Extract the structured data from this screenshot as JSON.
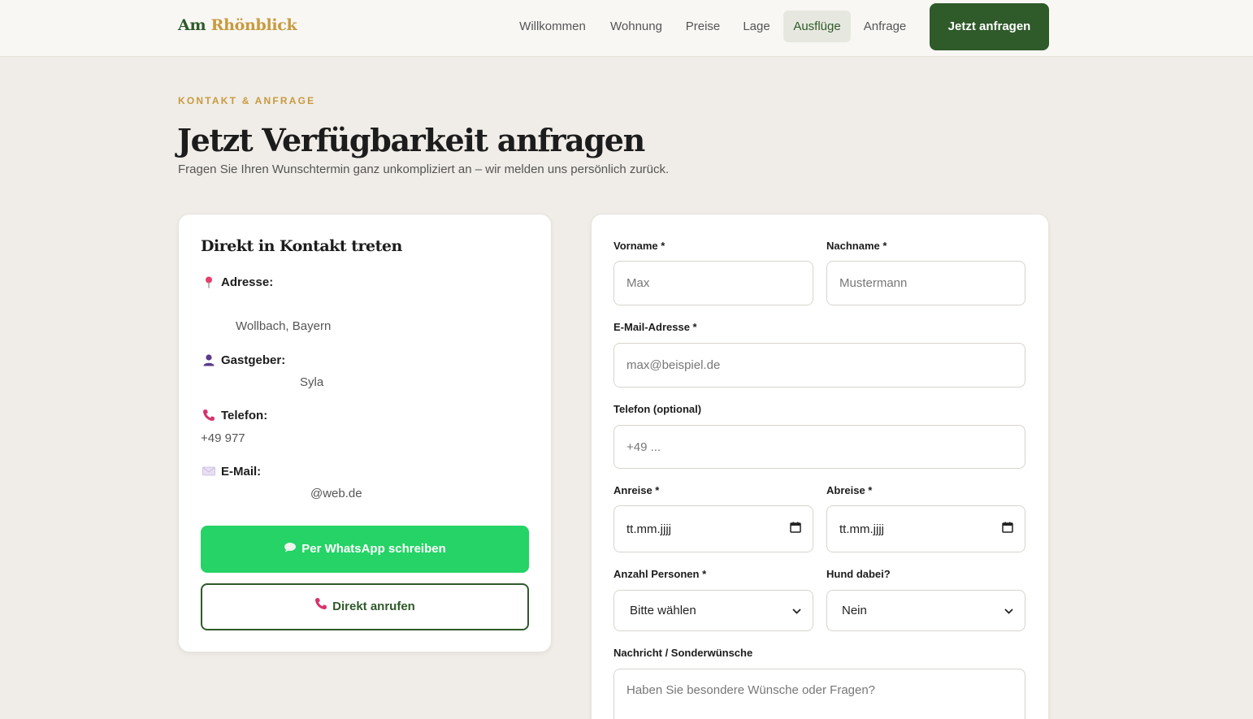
{
  "header": {
    "logo_part1": "Am",
    "logo_part2": "Rhönblick",
    "nav": [
      "Willkommen",
      "Wohnung",
      "Preise",
      "Lage",
      "Ausflüge",
      "Anfrage"
    ],
    "active_nav": "Ausflüge",
    "cta_label": "Jetzt anfragen"
  },
  "intro": {
    "eyebrow": "KONTAKT & ANFRAGE",
    "title": "Jetzt Verfügbarkeit anfragen",
    "subtitle": "Fragen Sie Ihren Wunschtermin ganz unkompliziert an – wir melden uns persönlich zurück."
  },
  "contact": {
    "title": "Direkt in Kontakt treten",
    "address_label": "Adresse:",
    "address_value": "Wollbach, Bayern",
    "host_label": "Gastgeber:",
    "host_value": "Syla",
    "phone_label": "Telefon:",
    "phone_value": "+49 977",
    "email_label": "E-Mail:",
    "email_value": "@web.de",
    "whatsapp_label": "Per WhatsApp schreiben",
    "call_label": "Direkt anrufen",
    "icons": [
      "pin-icon",
      "person-icon",
      "phone-icon",
      "mail-icon",
      "speech-bubble-icon"
    ]
  },
  "form": {
    "firstname_label": "Vorname *",
    "firstname_placeholder": "Max",
    "lastname_label": "Nachname *",
    "lastname_placeholder": "Mustermann",
    "email_label": "E-Mail-Adresse *",
    "email_placeholder": "max@beispiel.de",
    "phone_label": "Telefon (optional)",
    "phone_placeholder": "+49 ...",
    "arrival_label": "Anreise *",
    "arrival_placeholder": "tt.mm.jjjj",
    "departure_label": "Abreise *",
    "departure_placeholder": "tt.mm.jjjj",
    "persons_label": "Anzahl Personen *",
    "persons_value": "Bitte wählen",
    "dog_label": "Hund dabei?",
    "dog_value": "Nein",
    "message_label": "Nachricht / Sonderwünsche",
    "message_placeholder": "Haben Sie besondere Wünsche oder Fragen?"
  },
  "colors": {
    "brand_green": "#2f5a2a",
    "accent_gold": "#c79a3e",
    "whatsapp_green": "#25d366",
    "background": "#f0ede8"
  }
}
